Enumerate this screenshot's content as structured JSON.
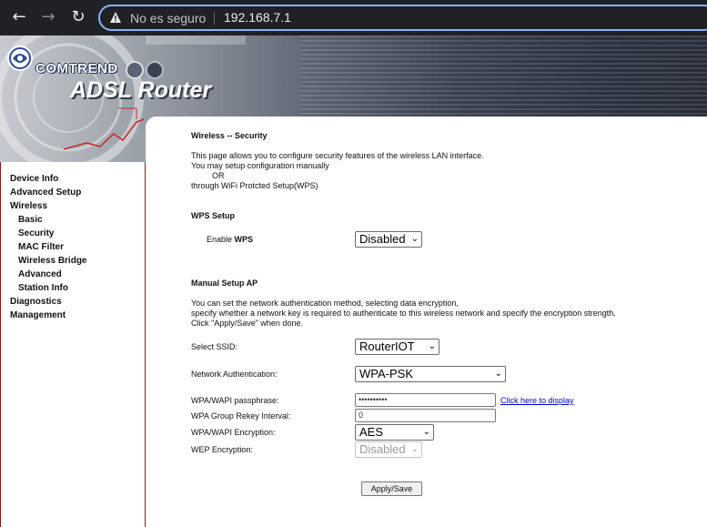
{
  "browser": {
    "security_label": "No es seguro",
    "url": "192.168.7.1"
  },
  "banner": {
    "brand": "COMTREND",
    "product": "ADSL Router"
  },
  "sidebar": {
    "items": [
      {
        "label": "Device Info",
        "level": 0
      },
      {
        "label": "Advanced Setup",
        "level": 0
      },
      {
        "label": "Wireless",
        "level": 0
      },
      {
        "label": "Basic",
        "level": 1
      },
      {
        "label": "Security",
        "level": 1
      },
      {
        "label": "MAC Filter",
        "level": 1
      },
      {
        "label": "Wireless Bridge",
        "level": 1
      },
      {
        "label": "Advanced",
        "level": 1
      },
      {
        "label": "Station Info",
        "level": 1
      },
      {
        "label": "Diagnostics",
        "level": 0
      },
      {
        "label": "Management",
        "level": 0
      }
    ]
  },
  "page": {
    "title": "Wireless -- Security",
    "intro_1": "This page allows you to configure security features of the wireless LAN interface.",
    "intro_2": "You may setup configuration manually",
    "intro_or": "OR",
    "intro_3": "through WiFi Protcted Setup(WPS)",
    "wps_heading": "WPS Setup",
    "wps_enable_prefix": "Enable ",
    "wps_enable_bold": "WPS",
    "wps_value": "Disabled",
    "manual_heading": "Manual Setup AP",
    "manual_1": "You can set the network authentication method, selecting data encryption,",
    "manual_2": "specify whether a network key is required to authenticate to this wireless network and specify the encryption strength.",
    "manual_3": "Click \"Apply/Save\" when done.",
    "ssid_label": "Select SSID:",
    "ssid_value": "RouterIOT",
    "auth_label": "Network Authentication:",
    "auth_value": "WPA-PSK",
    "pass_label": "WPA/WAPI passphrase:",
    "pass_value": "••••••••••",
    "pass_link": "Click here to display",
    "rekey_label": "WPA Group Rekey Interval:",
    "rekey_value": "0",
    "enc_label": "WPA/WAPI Encryption:",
    "enc_value": "AES",
    "wep_label": "WEP Encryption:",
    "wep_value": "Disabled",
    "apply_label": "Apply/Save"
  },
  "colors": {
    "sidebar_border": "#8b1a1a",
    "link": "#0000cc",
    "chrome_bg": "#202124",
    "omnibox_focus": "#8ab4f8"
  }
}
